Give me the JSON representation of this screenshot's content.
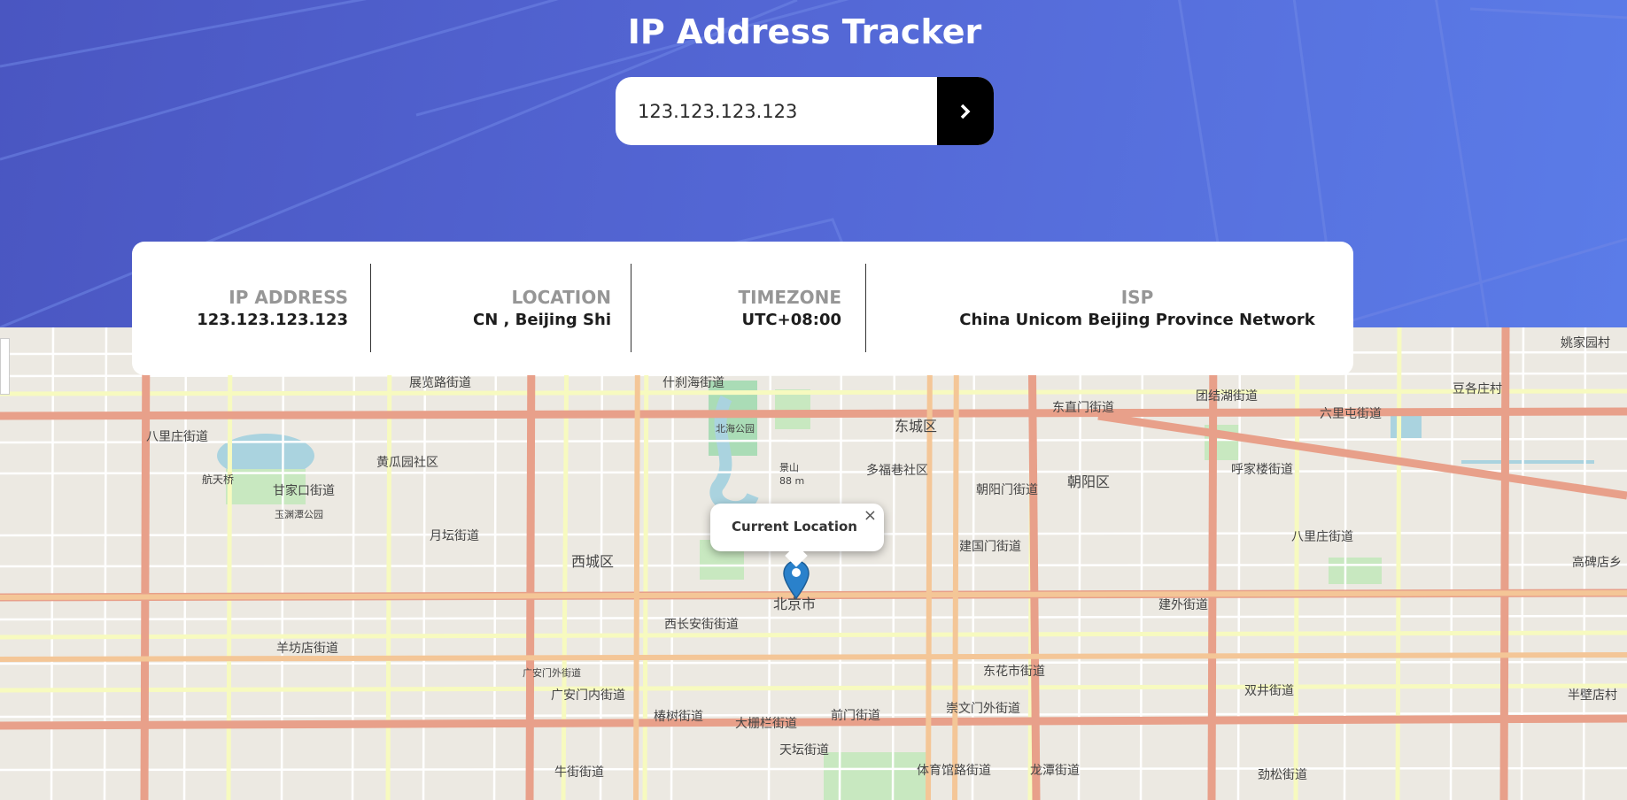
{
  "header": {
    "title": "IP Address Tracker",
    "search_value": "123.123.123.123",
    "submit_icon": "chevron-right-icon"
  },
  "info": {
    "ip": {
      "label": "IP ADDRESS",
      "value": "123.123.123.123"
    },
    "location": {
      "label": "LOCATION",
      "value": "CN , Beijing Shi"
    },
    "timezone": {
      "label": "TIMEZONE",
      "value": "UTC+08:00"
    },
    "isp": {
      "label": "ISP",
      "value": "China Unicom Beijing Province Network"
    }
  },
  "map": {
    "popup_text": "Current Location",
    "close_symbol": "×",
    "marker_icon": "map-pin-icon",
    "labels": [
      "八里庄街道",
      "展览路街道",
      "什刹海街道",
      "北海公园",
      "东城区",
      "东直门街道",
      "团结湖街道",
      "六里屯街道",
      "豆各庄村",
      "姚家园村",
      "黄瓜园社区",
      "甘家口街道",
      "航天桥",
      "玉渊潭公园",
      "月坛街道",
      "西城区",
      "景山",
      "88 m",
      "多福巷社区",
      "朝阳门街道",
      "朝阳区",
      "呼家楼街道",
      "八里庄街道",
      "建国门街道",
      "北京市",
      "西长安街街道",
      "建外街道",
      "高碑店乡",
      "羊坊店街道",
      "广安门内街道",
      "东花市街道",
      "双井街道",
      "牛街街道",
      "椿树街道",
      "大栅栏街道",
      "前门街道",
      "崇文门外街道",
      "天坛街道",
      "体育馆路街道",
      "龙潭街道",
      "劲松街道",
      "半壁店村",
      "广安门外街道"
    ]
  },
  "colors": {
    "header_gradient_start": "#4a56c1",
    "header_gradient_end": "#5b7ce8",
    "button_bg": "#000000",
    "label_gray": "#969696",
    "value_dark": "#1d1d1d",
    "marker_blue": "#2a81cb"
  }
}
